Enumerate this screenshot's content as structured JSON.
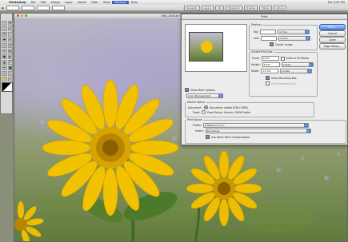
{
  "menubar": {
    "app": "Photoshop",
    "items": [
      "File",
      "Edit",
      "Image",
      "Layer",
      "Select",
      "Filter",
      "View",
      "Window",
      "Help"
    ],
    "active_index": 7,
    "clock": "Tue 3:24 PM"
  },
  "palette_well": {
    "tabs": [
      "Navigator",
      "Layers",
      "Info",
      "Histogram",
      "Brushes",
      "History",
      "Actions"
    ]
  },
  "document": {
    "title": "IMG_2340.tif @ 100% (RGB)"
  },
  "print_dialog": {
    "title": "Print",
    "position": {
      "label": "Position",
      "top_label": "Top:",
      "top_value": "",
      "top_unit": "inches",
      "left_label": "Left:",
      "left_value": "",
      "left_unit": "inches",
      "center_label": "Center Image",
      "center_checked": true
    },
    "scaled": {
      "label": "Scaled Print Size",
      "scale_label": "Scale:",
      "scale_value": "100%",
      "scale_to_fit_label": "Scale to Fit Media",
      "height_label": "Height:",
      "height_value": "8.347",
      "height_unit": "inches",
      "width_label": "Width:",
      "width_value": "11.111",
      "width_unit": "inches",
      "show_bbox_label": "Show Bounding Box",
      "show_bbox_checked": true,
      "print_sel_label": "Print Selected Area",
      "print_sel_checked": false
    },
    "show_more_label": "Show More Options",
    "show_more_checked": true,
    "mode_select": "Color Management",
    "source": {
      "label": "Source Space:",
      "document_label": "Document:",
      "document_value": "Document: Adobe RGB (1998)",
      "proof_label": "Proof:",
      "proof_value": "Proof Setup: Generic CMYK Profile"
    },
    "print_space": {
      "label": "Print Space:",
      "profile_label": "Profile:",
      "profile_value": "Z-BWGamma.icc",
      "intent_label": "Intent:",
      "intent_value": "Perceptual",
      "bpc_label": "Use Black Point Compensation",
      "bpc_checked": true
    },
    "buttons": [
      "Print...",
      "Cancel",
      "Done",
      "Page Setup..."
    ]
  },
  "colors": {
    "accent": "#4d7fd6",
    "menu_highlight": "#3b64c8",
    "petal": "#f2c200"
  }
}
